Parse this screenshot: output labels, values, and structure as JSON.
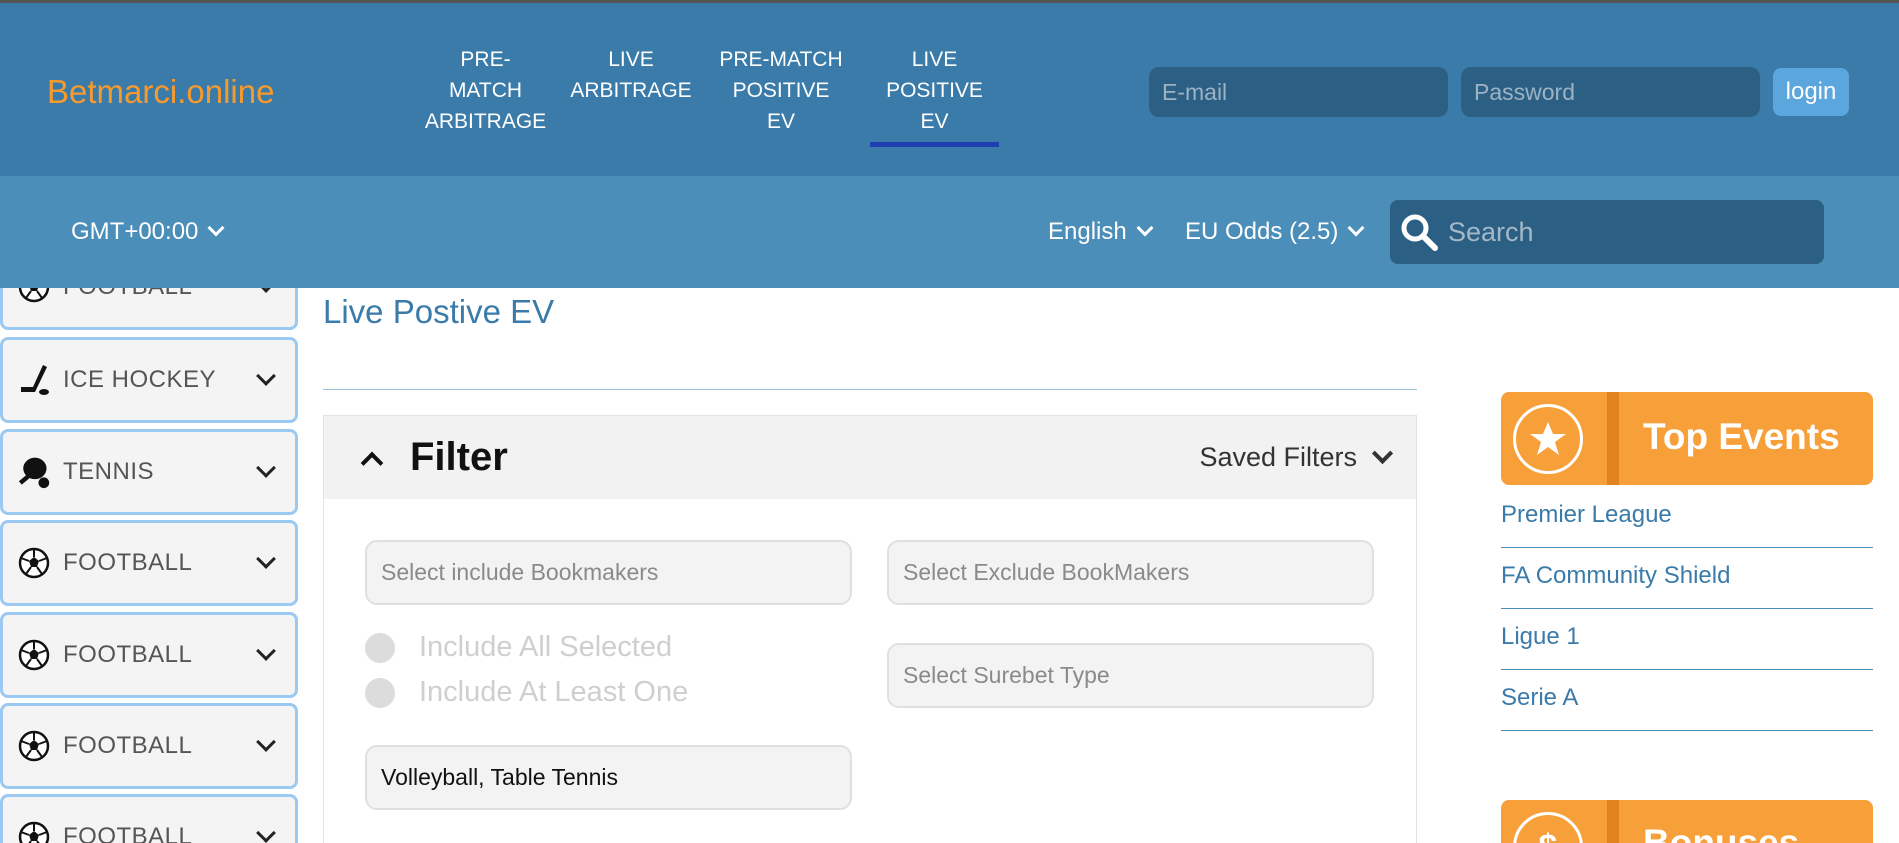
{
  "header": {
    "brand": "Betmarci.online",
    "nav": [
      {
        "label": "PRE-\nMATCH\nARBITRAGE",
        "active": false
      },
      {
        "label": "LIVE\nARBITRAGE",
        "active": false
      },
      {
        "label": "PRE-MATCH\nPOSITIVE\nEV",
        "active": false
      },
      {
        "label": "LIVE\nPOSITIVE\nEV",
        "active": true
      }
    ],
    "email_placeholder": "E-mail",
    "password_placeholder": "Password",
    "login_label": "login"
  },
  "subbar": {
    "timezone": "GMT+00:00",
    "language": "English",
    "odds_format": "EU Odds (2.5)",
    "search_placeholder": "Search"
  },
  "sidebar": {
    "items": [
      {
        "label": "FOOTBALL",
        "icon": "football-icon"
      },
      {
        "label": "ICE HOCKEY",
        "icon": "ice-hockey-icon"
      },
      {
        "label": "TENNIS",
        "icon": "tennis-icon"
      },
      {
        "label": "FOOTBALL",
        "icon": "football-icon"
      },
      {
        "label": "FOOTBALL",
        "icon": "football-icon"
      },
      {
        "label": "FOOTBALL",
        "icon": "football-icon"
      },
      {
        "label": "FOOTBALL",
        "icon": "football-icon"
      }
    ]
  },
  "main": {
    "title": "Live Postive EV",
    "filter": {
      "title": "Filter",
      "saved_filters": "Saved Filters",
      "include_bookmakers_placeholder": "Select include Bookmakers",
      "exclude_bookmakers_placeholder": "Select Exclude BookMakers",
      "surebet_type_placeholder": "Select Surebet Type",
      "radio_options": [
        "Include All Selected",
        "Include At Least One"
      ],
      "sports_value": "Volleyball, Table Tennis"
    }
  },
  "right": {
    "top_events_title": "Top Events",
    "events": [
      "Premier League",
      "FA Community Shield",
      "Ligue 1",
      "Serie A"
    ],
    "bonuses_title": "Bonuses"
  },
  "colors": {
    "header_bg": "#3a7ba9",
    "subbar_bg": "#4a8eb9",
    "brand": "#f79a2e",
    "accent_orange": "#f7a03a",
    "active_underline": "#1d3fb0"
  }
}
